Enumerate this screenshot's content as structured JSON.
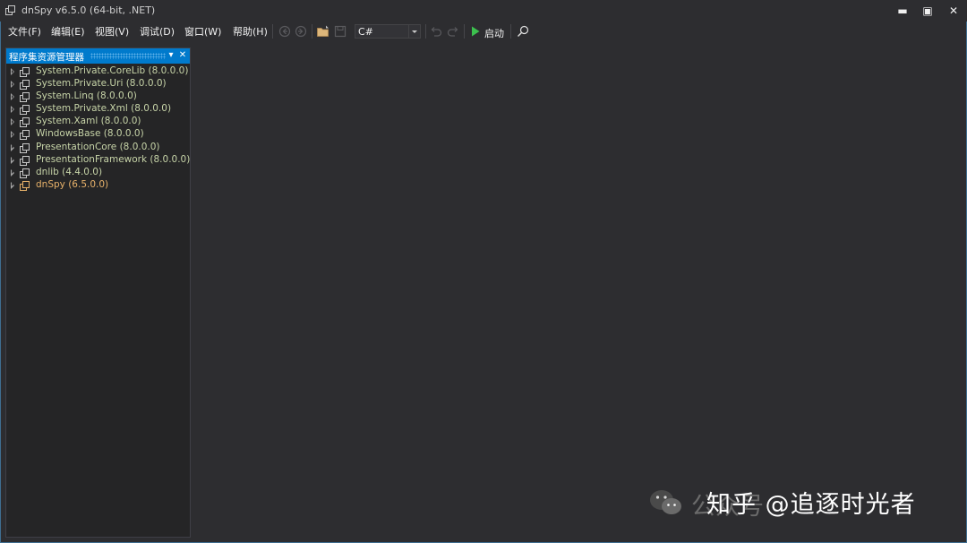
{
  "window": {
    "title": "dnSpy v6.5.0 (64-bit, .NET)",
    "controls": {
      "minimize": "▬",
      "maximize": "▣",
      "close": "✕"
    }
  },
  "menu": {
    "items": [
      "文件(F)",
      "编辑(E)",
      "视图(V)",
      "调试(D)",
      "窗口(W)",
      "帮助(H)"
    ]
  },
  "toolbar": {
    "language": "C#",
    "start_label": "启动",
    "icons": [
      "back-icon",
      "forward-icon",
      "open-file-icon",
      "save-icon",
      "undo-icon",
      "redo-icon",
      "play-icon",
      "search-icon"
    ]
  },
  "assembly_explorer": {
    "title": "程序集资源管理器",
    "pin": "▾",
    "close": "✕",
    "items": [
      "System.Private.CoreLib (8.0.0.0)",
      "System.Private.Uri (8.0.0.0)",
      "System.Linq (8.0.0.0)",
      "System.Private.Xml (8.0.0.0)",
      "System.Xaml (8.0.0.0)",
      "WindowsBase (8.0.0.0)",
      "PresentationCore (8.0.0.0)",
      "PresentationFramework (8.0.0.0)",
      "dnlib (4.4.0.0)",
      "dnSpy (6.5.0.0)"
    ]
  },
  "watermark": {
    "faded": "公众号",
    "text": "知乎 @追逐时光者"
  },
  "colors": {
    "accent": "#007acc",
    "background": "#2d2d30",
    "panel": "#252526",
    "assembly_text": "#c7d4a8",
    "active_assembly_text": "#e8b26a",
    "start_green": "#3cc14e"
  }
}
